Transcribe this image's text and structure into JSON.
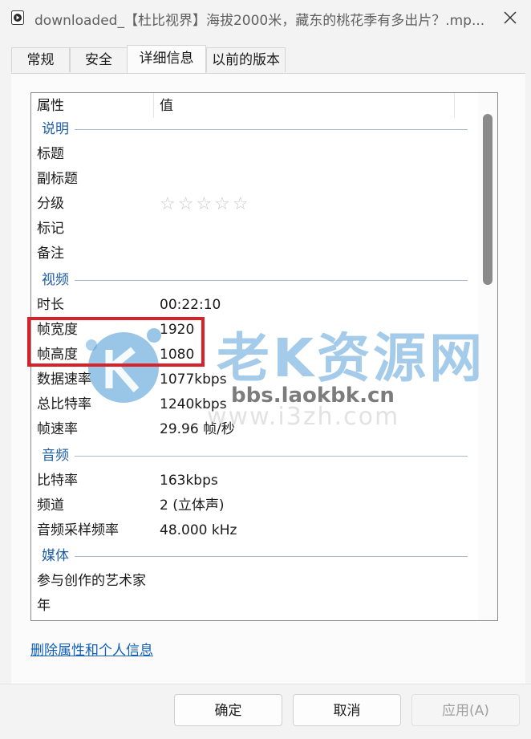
{
  "window": {
    "title": "downloaded_【杜比视界】海拔2000米，藏东的桃花季有多出片？.mp..."
  },
  "tabs": [
    {
      "label": "常规",
      "active": false
    },
    {
      "label": "安全",
      "active": false
    },
    {
      "label": "详细信息",
      "active": true
    },
    {
      "label": "以前的版本",
      "active": false
    }
  ],
  "list": {
    "header": {
      "property": "属性",
      "value": "值"
    },
    "groups": {
      "description": "说明",
      "video": "视频",
      "audio": "音频",
      "media": "媒体"
    },
    "rows": {
      "title": {
        "name": "标题",
        "value": ""
      },
      "subtitle": {
        "name": "副标题",
        "value": ""
      },
      "rating": {
        "name": "分级",
        "stars": "☆☆☆☆☆",
        "value_count": 0
      },
      "tags": {
        "name": "标记",
        "value": ""
      },
      "comments": {
        "name": "备注",
        "value": ""
      },
      "length": {
        "name": "时长",
        "value": "00:22:10"
      },
      "frame_width": {
        "name": "帧宽度",
        "value": "1920"
      },
      "frame_height": {
        "name": "帧高度",
        "value": "1080"
      },
      "data_rate": {
        "name": "数据速率",
        "value": "1077kbps"
      },
      "total_bitrate": {
        "name": "总比特率",
        "value": "1240kbps"
      },
      "frame_rate": {
        "name": "帧速率",
        "value": "29.96 帧/秒"
      },
      "bitrate": {
        "name": "比特率",
        "value": "163kbps"
      },
      "channels": {
        "name": "频道",
        "value": "2 (立体声)"
      },
      "sample_rate": {
        "name": "音频采样频率",
        "value": "48.000 kHz"
      },
      "contributing_artists": {
        "name": "参与创作的艺术家",
        "value": ""
      },
      "year": {
        "name": "年",
        "value": ""
      }
    }
  },
  "watermark": {
    "brand": "老K资源网",
    "url1": "bbs.laokbk.cn",
    "url2": "www.i3zh.com"
  },
  "link": {
    "remove_properties": "删除属性和个人信息"
  },
  "buttons": {
    "ok": "确定",
    "cancel": "取消",
    "apply": "应用(A)"
  },
  "colors": {
    "accent_group": "#1e5ea8",
    "highlight": "#d8222a",
    "link": "#1060b8"
  }
}
